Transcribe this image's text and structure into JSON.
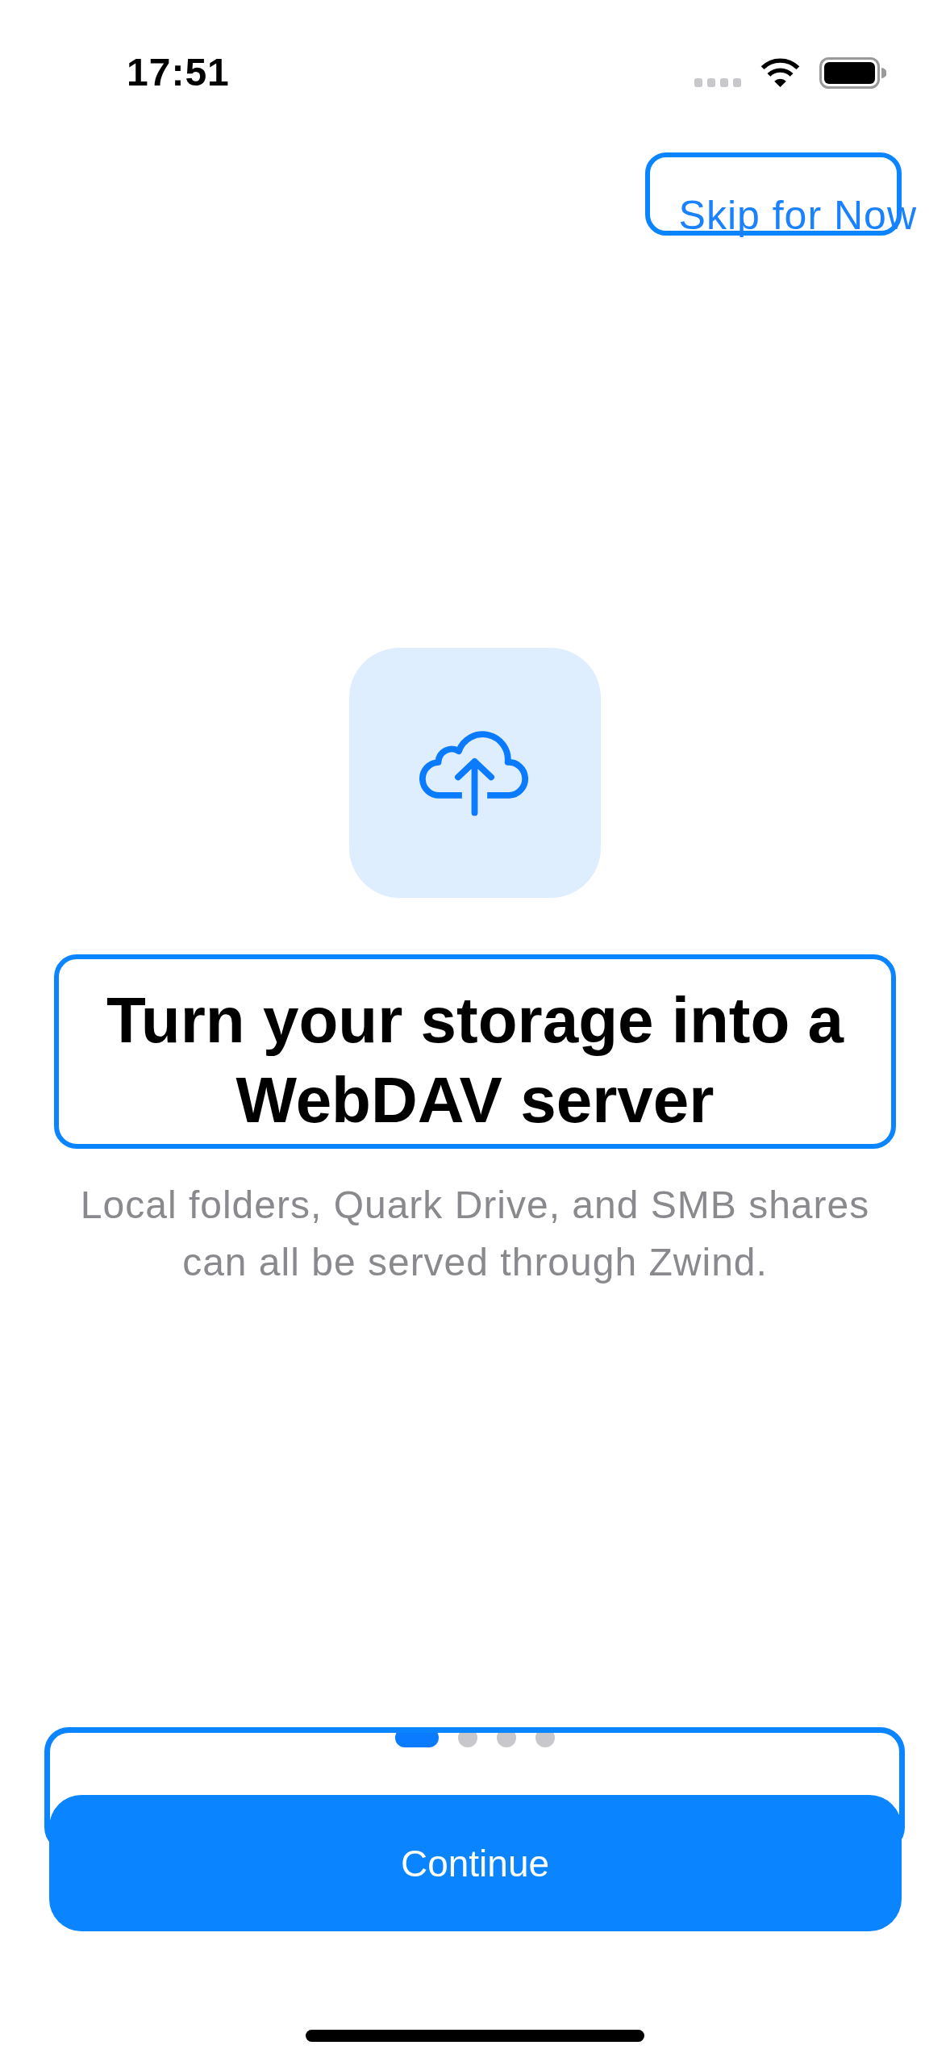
{
  "status_bar": {
    "time": "17:51"
  },
  "skip_button": {
    "label": "Skip for Now"
  },
  "hero": {
    "title": "Turn your storage into a WebDAV server",
    "subtitle": "Local folders, Quark Drive, and SMB shares can all be served through Zwind."
  },
  "page_indicator": [
    {
      "selected": true
    },
    {
      "selected": false
    },
    {
      "selected": false
    },
    {
      "selected": false
    }
  ],
  "continue_button": {
    "label": "Continue"
  }
}
